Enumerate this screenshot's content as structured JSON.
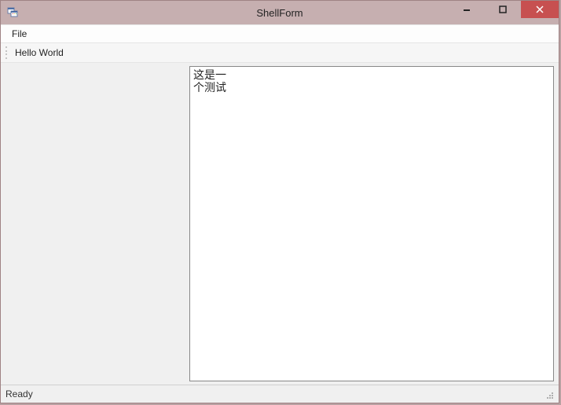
{
  "window": {
    "title": "ShellForm"
  },
  "menubar": {
    "items": [
      {
        "label": "File"
      }
    ]
  },
  "toolbar": {
    "label": "Hello World"
  },
  "editor": {
    "text": "这是一\n个测试"
  },
  "statusbar": {
    "text": "Ready"
  }
}
